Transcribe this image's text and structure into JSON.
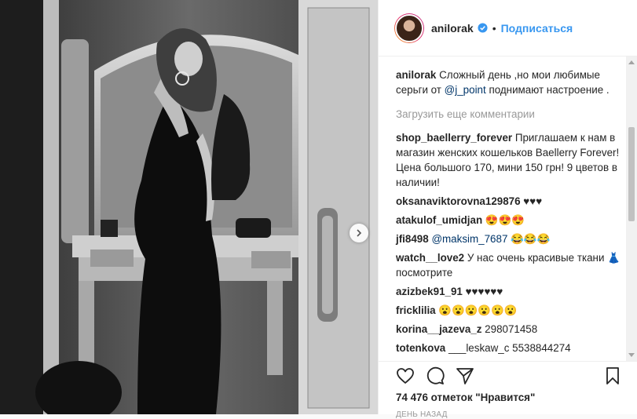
{
  "post": {
    "image_alt": "",
    "next_icon": "chevron-right-icon"
  },
  "header": {
    "username": "anilorak",
    "dot": "•",
    "follow_label": "Подписаться"
  },
  "caption": {
    "username": "anilorak",
    "text_before": "Сложный день ,но мои любимые серьги от ",
    "mention": "@j_point",
    "text_after": " поднимают настроение ."
  },
  "load_more": "Загрузить еще комментарии",
  "comments": [
    {
      "username": "shop_baellerry_forever",
      "text": "Приглашаем к нам в магазин женских кошельков Baellerry Forever! Цена большого 170, мини 150 грн! 9 цветов в наличии!"
    },
    {
      "username": "oksanaviktorovna129876",
      "text": "♥♥♥"
    },
    {
      "username": "atakulof_umidjan",
      "text": "😍😍😍"
    },
    {
      "username": "jfi8498",
      "mention": "@maksim_7687",
      "text": "😂😂😂"
    },
    {
      "username": "watch__love2",
      "text": "У нас очень красивые ткани 👗 посмотрите"
    },
    {
      "username": "azizbek91_91",
      "text": "♥♥♥♥♥♥"
    },
    {
      "username": "fricklilia",
      "text": "😮😮😮😮😮😮"
    },
    {
      "username": "korina__jazeva_z",
      "text": "298071458"
    },
    {
      "username": "totenkova",
      "text": "___leskaw_c 5538844274"
    }
  ],
  "likes": "74 476 отметок \"Нравится\"",
  "timestamp": "ДЕНЬ НАЗАД",
  "colors": {
    "link": "#3897f0",
    "mention": "#003569",
    "muted": "#999999"
  }
}
